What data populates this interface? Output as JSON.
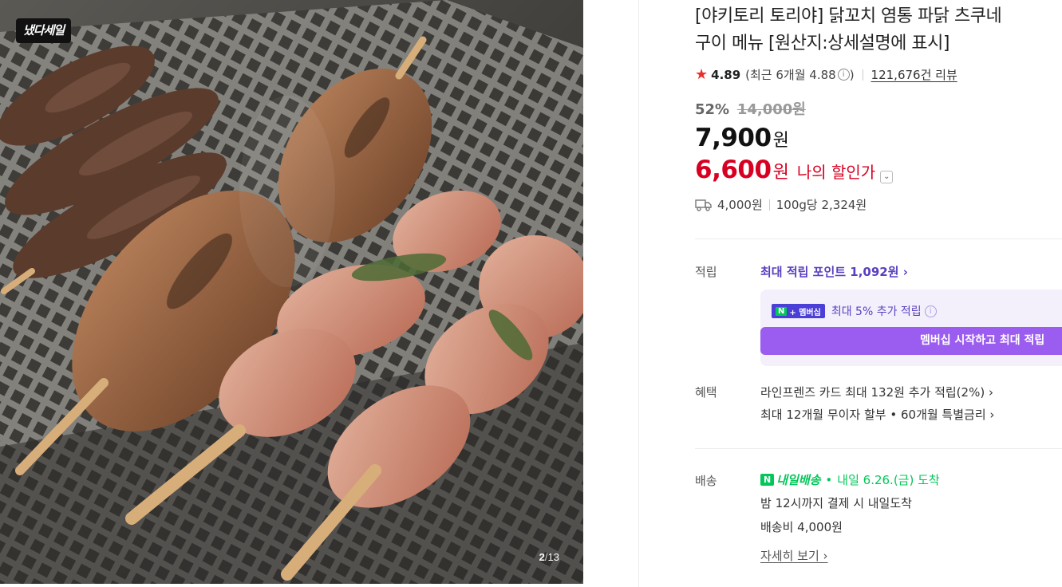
{
  "image": {
    "badge": "냈다세일",
    "counter_current": "2",
    "counter_sep": "/",
    "counter_total": "13"
  },
  "product": {
    "title_line1": "[야키토리 토리야] 닭꼬치 염통 파닭 츠쿠네",
    "title_line2": "구이 메뉴 [원산지:상세설명에 표시]",
    "rating": "4.89",
    "recent_rating": "(최근 6개월 4.88",
    "recent_close": ")",
    "info_icon": "i",
    "reviews": "121,676건 리뷰",
    "discount_rate": "52%",
    "original_price": "14,000원",
    "price": "7,900",
    "price_unit": "원",
    "my_price": "6,600",
    "my_price_unit": "원",
    "my_price_label": "나의 할인가",
    "shipping_fee": "4,000원",
    "unit_price": "100g당 2,324원"
  },
  "points": {
    "label": "적립",
    "max_points": "최대 적립 포인트 1,092원 ›",
    "member_badge_n": "N",
    "member_badge": "+ 멤버십",
    "member_extra": "최대 5% 추가 적립",
    "member_button": "멤버십 시작하고 최대 적립"
  },
  "benefits": {
    "label": "혜택",
    "line1": "라인프렌즈 카드 최대 132원 추가 적립(2%) ›",
    "line2": "최대 12개월 무이자 할부 • 60개월 특별금리 ›"
  },
  "delivery": {
    "label": "배송",
    "badge_n": "N",
    "badge_text": "내일배송",
    "dot": "•",
    "arrive": "내일 6.26.(금) 도착",
    "cutoff": "밤 12시까지 결제 시 내일도착",
    "fee": "배송비 4,000원",
    "detail_link": "자세히 보기 ›"
  },
  "colors": {
    "accent_purple": "#5a3fc0",
    "sale_red": "#d70021",
    "naver_green": "#03c75a",
    "member_button": "#9b5cf0"
  },
  "icons": {
    "rating": "star-icon",
    "shipping": "truck-icon",
    "dropdown": "chevron-down-icon"
  }
}
